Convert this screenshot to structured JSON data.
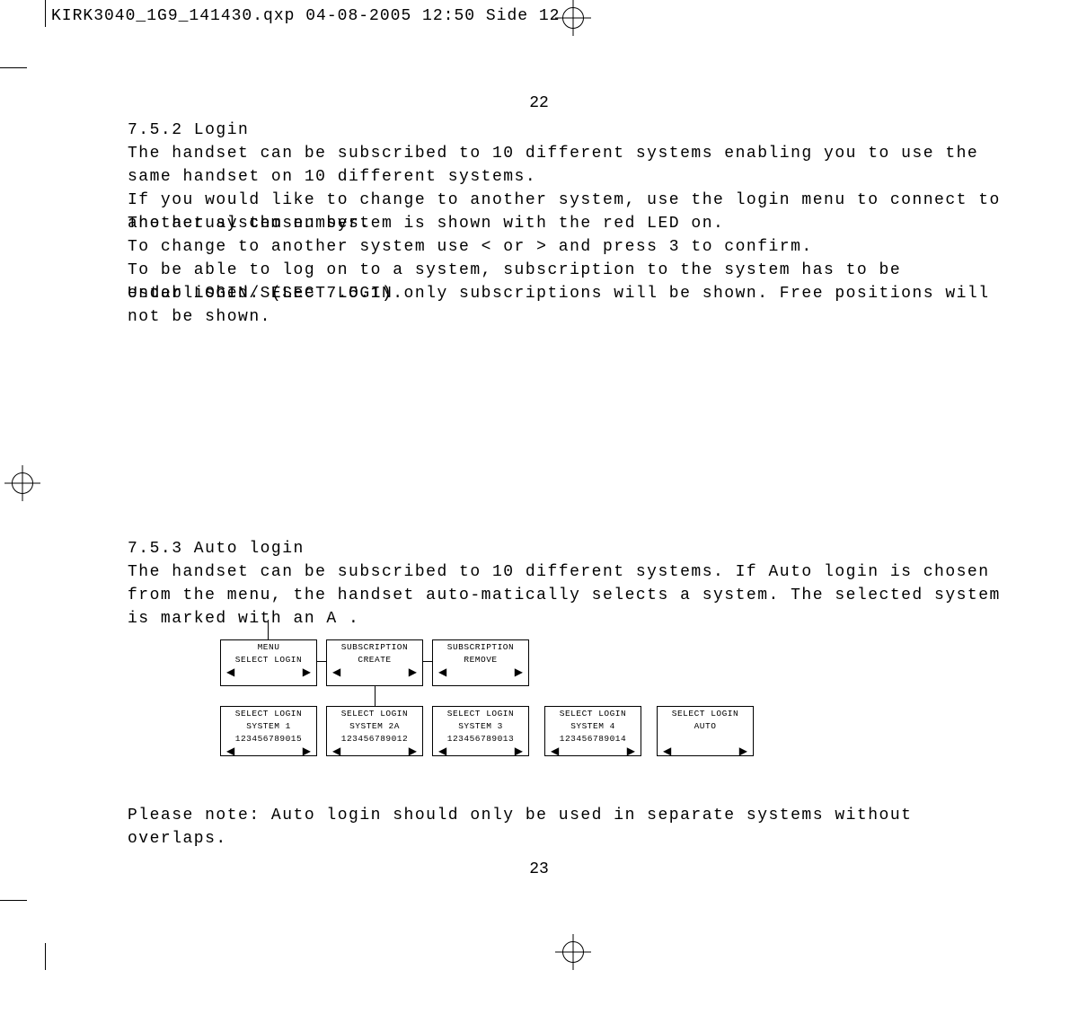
{
  "header": "KIRK3040_1G9_141430.qxp  04-08-2005  12:50  Side 12",
  "page_num_top": "22",
  "section1": {
    "heading": "7.5.2 Login",
    "p1": "The handset can be subscribed to 10 different systems enabling you to use the same handset on 10 different systems.",
    "p2": "If you would like to change to another system, use the login menu to connect to another system number.",
    "p3": "The actual chosen system is shown with the red LED on.",
    "p4": "To change to another system use < or > and press  3 to confirm.",
    "p5": "To be able to log on to a system, subscription to the system has to be established. (See 7.5.1).",
    "p6": "Under  LOGIN/SELECT LOGIN only subscriptions will be shown. Free positions will not be shown."
  },
  "section2": {
    "heading": "7.5.3 Auto login",
    "p1": "The handset can be subscribed to 10 different systems. If Auto login is chosen from the menu, the handset auto-matically selects a system. The selected system is marked with an  A .",
    "note": "Please note: Auto login should only be used in separate systems without overlaps."
  },
  "page_num_bottom": "23",
  "arrow_left": "◀",
  "arrow_right": "▶",
  "top_boxes": [
    {
      "l1": "MENU",
      "l2": "SELECT LOGIN",
      "l3": ""
    },
    {
      "l1": "SUBSCRIPTION",
      "l2": "CREATE",
      "l3": ""
    },
    {
      "l1": "SUBSCRIPTION",
      "l2": "REMOVE",
      "l3": ""
    }
  ],
  "bottom_boxes": [
    {
      "l1": "SELECT LOGIN",
      "l2": "SYSTEM 1",
      "l3": "123456789015"
    },
    {
      "l1": "SELECT LOGIN",
      "l2": "SYSTEM 2A",
      "l3": "123456789012"
    },
    {
      "l1": "SELECT LOGIN",
      "l2": "SYSTEM 3",
      "l3": "123456789013"
    },
    {
      "l1": "SELECT LOGIN",
      "l2": "SYSTEM 4",
      "l3": "123456789014"
    },
    {
      "l1": "SELECT LOGIN",
      "l2": "AUTO",
      "l3": ""
    }
  ]
}
